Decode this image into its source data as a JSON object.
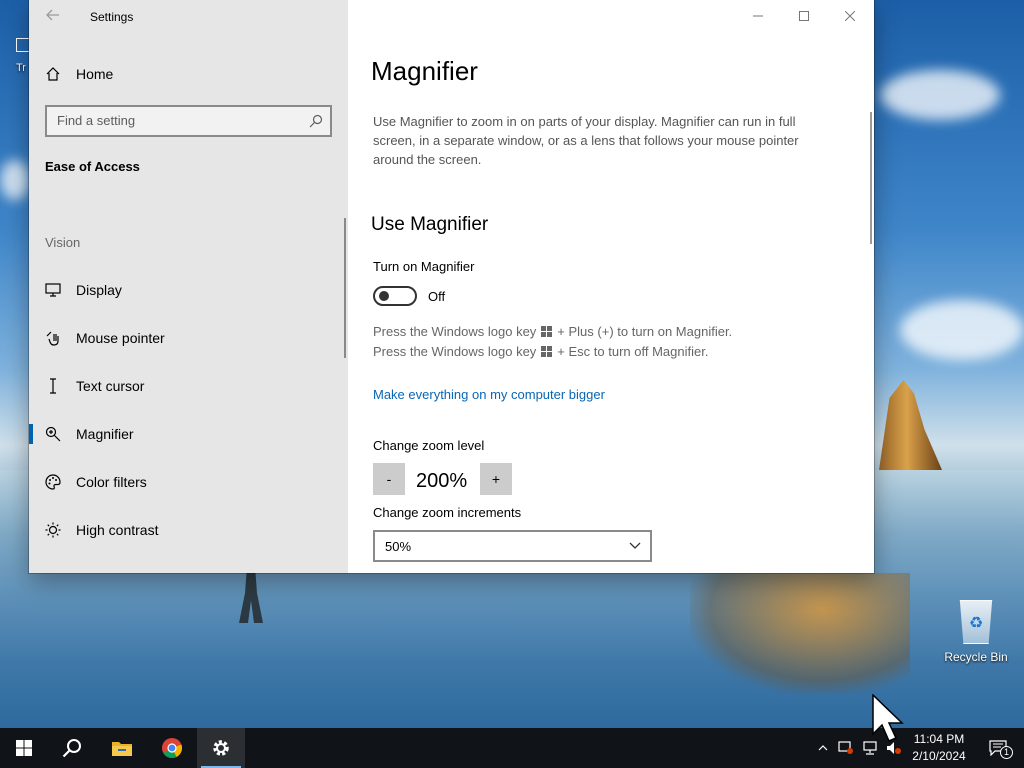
{
  "window": {
    "title": "Settings",
    "back_icon": "back-arrow-icon",
    "controls": [
      "minimize-icon",
      "maximize-icon",
      "close-icon"
    ]
  },
  "sidebar": {
    "home_label": "Home",
    "search_placeholder": "Find a setting",
    "section_title": "Ease of Access",
    "group_label": "Vision",
    "items": [
      {
        "label": "Display",
        "icon": "monitor-icon",
        "active": false
      },
      {
        "label": "Mouse pointer",
        "icon": "mouse-pointer-icon",
        "active": false
      },
      {
        "label": "Text cursor",
        "icon": "text-cursor-icon",
        "active": false
      },
      {
        "label": "Magnifier",
        "icon": "magnifier-icon",
        "active": true
      },
      {
        "label": "Color filters",
        "icon": "palette-icon",
        "active": false
      },
      {
        "label": "High contrast",
        "icon": "brightness-icon",
        "active": false
      }
    ]
  },
  "main": {
    "title": "Magnifier",
    "description": "Use Magnifier to zoom in on parts of your display. Magnifier can run in full screen, in a separate window, or as a lens that follows your mouse pointer around the screen.",
    "section_title": "Use Magnifier",
    "toggle_label": "Turn on Magnifier",
    "toggle_state": "Off",
    "hint1_before": "Press the Windows logo key",
    "hint1_after": "+ Plus (+) to turn on Magnifier.",
    "hint2_before": "Press the Windows logo key",
    "hint2_after": "+ Esc to turn off Magnifier.",
    "link": "Make everything on my computer bigger",
    "zoom_label": "Change zoom level",
    "zoom_minus": "-",
    "zoom_value": "200%",
    "zoom_plus": "+",
    "increments_label": "Change zoom increments",
    "increments_value": "50%"
  },
  "desktop": {
    "recycle_bin_label": "Recycle Bin",
    "left_partial_label": "Tr"
  },
  "taskbar": {
    "apps": [
      "start-icon",
      "search-icon",
      "file-explorer-icon",
      "chrome-icon",
      "settings-icon"
    ],
    "time": "11:04 PM",
    "date": "2/10/2024",
    "notification_count": "1",
    "colors": {
      "background": "#101418",
      "accent": "#0063b1"
    }
  }
}
